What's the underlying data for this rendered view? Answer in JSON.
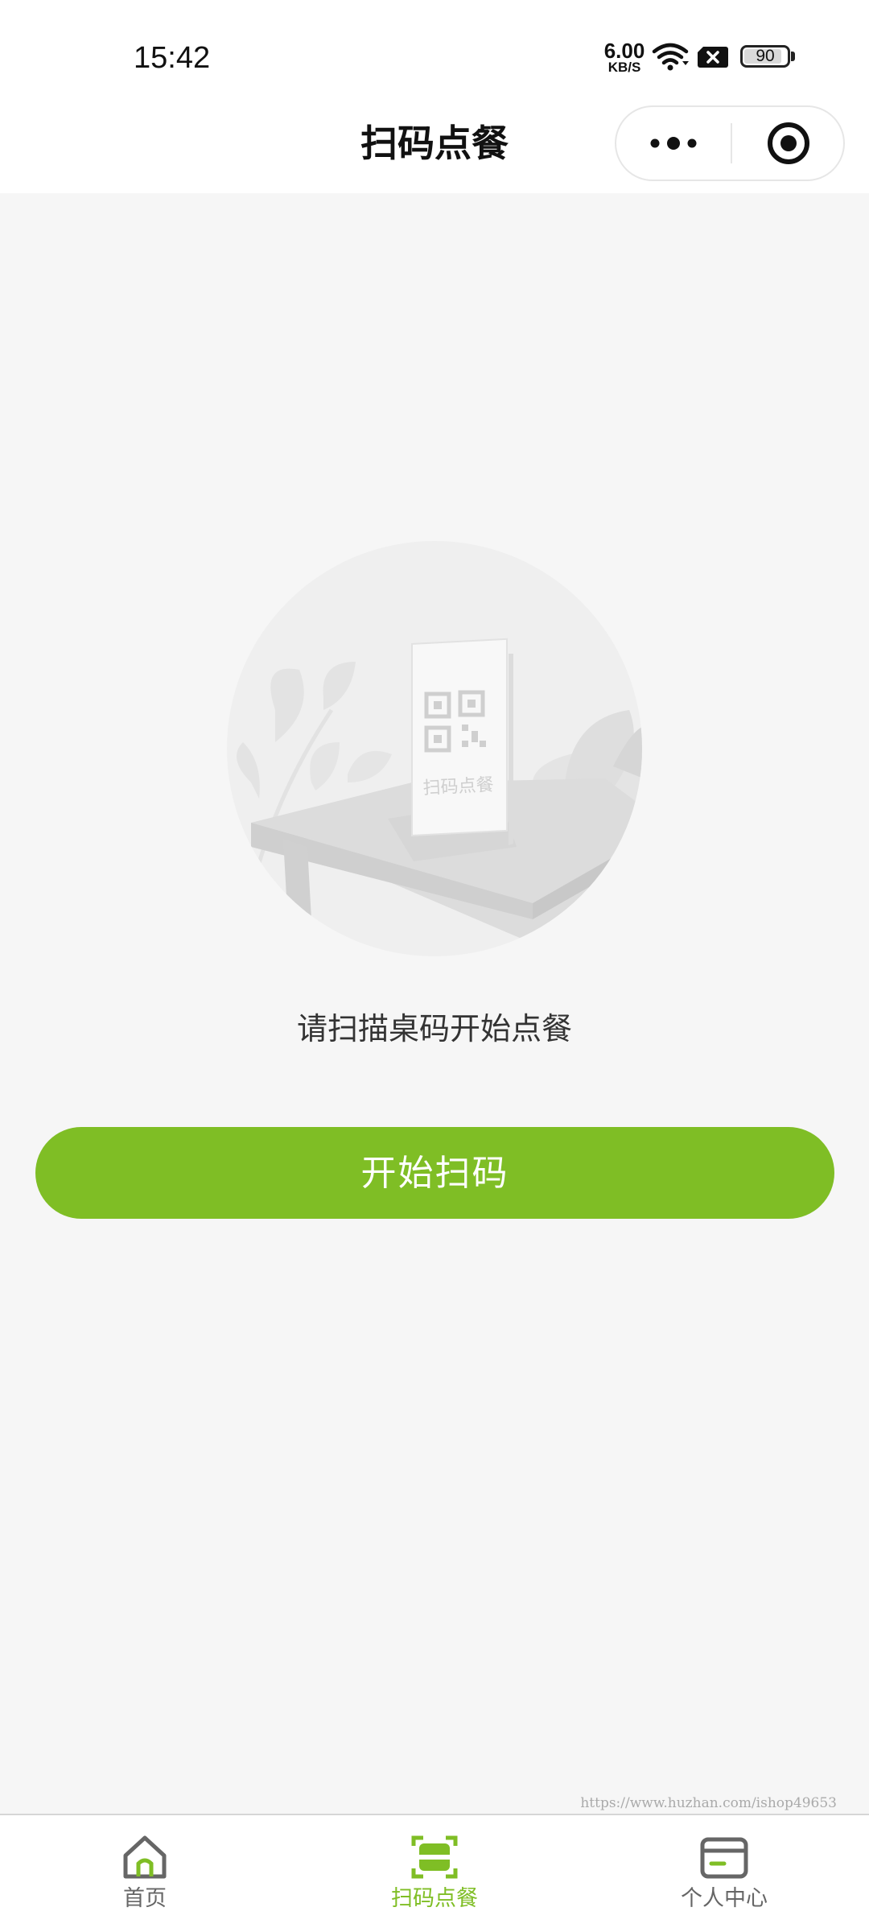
{
  "status_bar": {
    "time": "15:42",
    "net_speed_value": "6.00",
    "net_speed_unit": "KB/S",
    "battery_level": "90",
    "icons": [
      "wifi-icon",
      "sim-blocked-icon",
      "battery-icon"
    ]
  },
  "nav": {
    "title": "扫码点餐",
    "more_icon": "more-dots-icon",
    "close_icon": "target-close-icon"
  },
  "content": {
    "illustration_text": "扫码点餐",
    "prompt": "请扫描桌码开始点餐",
    "button_label": "开始扫码",
    "watermark": "https://www.huzhan.com/ishop49653"
  },
  "tabs": [
    {
      "label": "首页",
      "icon": "home-icon",
      "active": false
    },
    {
      "label": "扫码点餐",
      "icon": "scan-icon",
      "active": true
    },
    {
      "label": "个人中心",
      "icon": "card-icon",
      "active": false
    }
  ],
  "colors": {
    "accent": "#7fbe25",
    "background": "#f6f6f6",
    "tab_inactive": "#666666"
  }
}
